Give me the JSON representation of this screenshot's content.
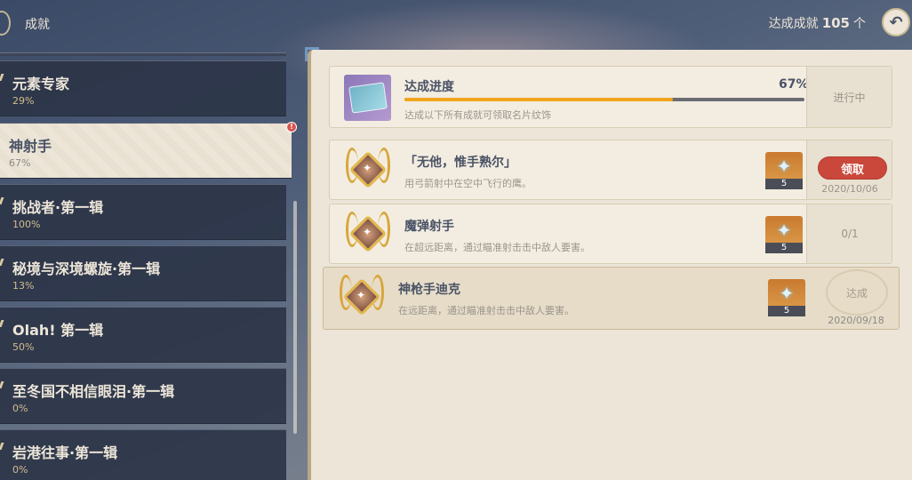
{
  "header": {
    "title": "成就",
    "count_label": "达成成就",
    "count_value": "105",
    "count_unit": "个",
    "back_icon": "back-arrow-icon"
  },
  "categories": [
    {
      "name": "元素专家",
      "pct": "29%"
    },
    {
      "name": "神射手",
      "pct": "67%",
      "active": true
    },
    {
      "name": "挑战者·第一辑",
      "pct": "100%"
    },
    {
      "name": "秘境与深境螺旋·第一辑",
      "pct": "13%"
    },
    {
      "name": "Olah! 第一辑",
      "pct": "50%"
    },
    {
      "name": "至冬国不相信眼泪·第一辑",
      "pct": "0%"
    },
    {
      "name": "岩港往事·第一辑",
      "pct": "0%"
    }
  ],
  "notif_badge": "!",
  "progress": {
    "title": "达成进度",
    "percent_label": "67%",
    "percent_value": 0.67,
    "subtitle": "达成以下所有成就可领取名片纹饰",
    "status": "进行中"
  },
  "achievements": [
    {
      "title": "「无他，惟手熟尔」",
      "desc": "用弓箭射中在空中飞行的鹰。",
      "reward_qty": "5",
      "claim_label": "领取",
      "date": "2020/10/06"
    },
    {
      "title": "魔弹射手",
      "desc": "在超远距离，通过瞄准射击击中敌人要害。",
      "reward_qty": "5",
      "progress": "0/1"
    },
    {
      "title": "神枪手迪克",
      "desc": "在远距离，通过瞄准射击击中敌人要害。",
      "reward_qty": "5",
      "seal": "达成",
      "date": "2020/09/18"
    }
  ],
  "colors": {
    "accent_gold": "#f0a51e",
    "claim_red": "#c9483b",
    "panel_bg": "#ece5d8",
    "dark_text": "#4a5366"
  }
}
